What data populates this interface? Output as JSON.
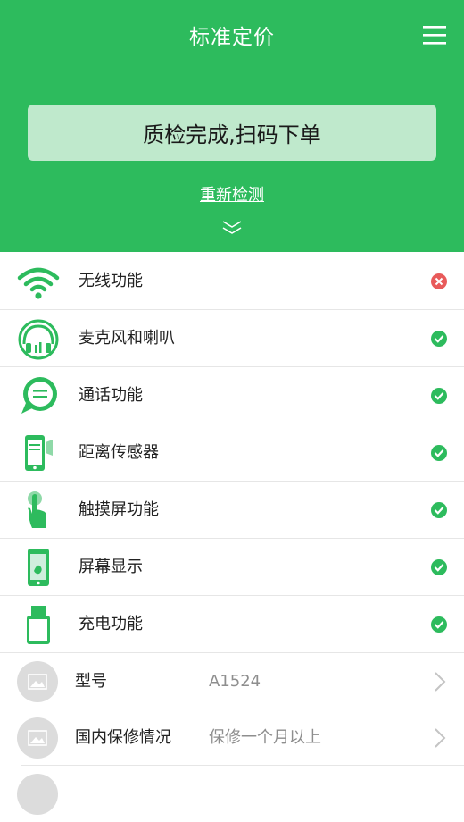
{
  "header": {
    "title": "标准定价",
    "banner": "质检完成,扫码下单",
    "recheck": "重新检测"
  },
  "checks": [
    {
      "label": "无线功能",
      "status": "fail",
      "icon": "wifi-icon"
    },
    {
      "label": "麦克风和喇叭",
      "status": "pass",
      "icon": "headphone-icon"
    },
    {
      "label": "通话功能",
      "status": "pass",
      "icon": "chat-bubble-icon"
    },
    {
      "label": "距离传感器",
      "status": "pass",
      "icon": "proximity-sensor-icon"
    },
    {
      "label": "触摸屏功能",
      "status": "pass",
      "icon": "touch-hand-icon"
    },
    {
      "label": "屏幕显示",
      "status": "pass",
      "icon": "phone-screen-icon"
    },
    {
      "label": "充电功能",
      "status": "pass",
      "icon": "charger-icon"
    }
  ],
  "info": [
    {
      "label": "型号",
      "value": "A1524"
    },
    {
      "label": "国内保修情况",
      "value": "保修一个月以上"
    }
  ],
  "colors": {
    "brand": "#2dbb5d",
    "fail": "#e85a5a",
    "pass": "#2dbb5d"
  }
}
